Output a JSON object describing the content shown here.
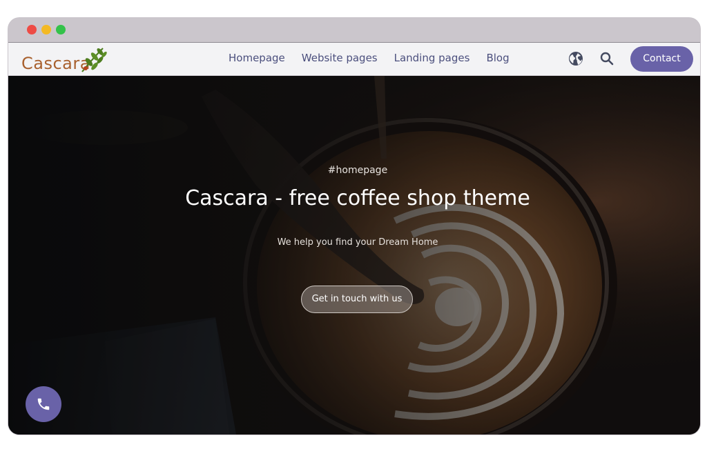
{
  "window": {
    "controls": {
      "close_color": "#ee4b45",
      "minimize_color": "#f4b924",
      "maximize_color": "#34c24a"
    }
  },
  "navbar": {
    "logo_text": "Cascara",
    "logo_color": "#a8602e",
    "leaf_color": "#4e7d1f",
    "links": [
      {
        "label": "Homepage"
      },
      {
        "label": "Website pages"
      },
      {
        "label": "Landing pages"
      },
      {
        "label": "Blog"
      }
    ],
    "link_color": "#4b4f7d",
    "globe_icon": "globe-icon",
    "search_icon": "search-icon",
    "contact_label": "Contact",
    "accent_color": "#6962a8"
  },
  "hero": {
    "hashtag": "#homepage",
    "title": "Cascara - free coffee shop theme",
    "subtitle": "We help you find your Dream Home",
    "cta_label": "Get in touch with us",
    "background": "latte-art-coffee-cup"
  },
  "floating": {
    "phone_icon": "phone-icon"
  }
}
